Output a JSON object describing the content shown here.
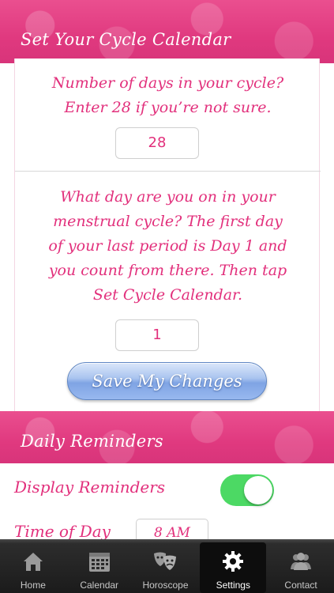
{
  "cycle_section": {
    "title": "Set Your Cycle Calendar",
    "days_prompt_line1": "Number of days in your cycle?",
    "days_prompt_line2": "Enter 28 if you’re not sure.",
    "days_value": "28",
    "day_prompt_line1": "What day are you on in your",
    "day_prompt_line2": "menstrual cycle? The first day",
    "day_prompt_line3": "of your last period is Day 1 and",
    "day_prompt_line4": "you count from there. Then tap",
    "day_prompt_line5": "Set Cycle Calendar.",
    "day_value": "1",
    "save_label": "Save My Changes"
  },
  "reminders_section": {
    "title": "Daily Reminders",
    "display_label": "Display Reminders",
    "display_on": true,
    "time_label": "Time of Day",
    "time_value": "8 AM"
  },
  "tabbar": {
    "tabs": [
      {
        "label": "Home",
        "icon": "home-icon"
      },
      {
        "label": "Calendar",
        "icon": "calendar-icon"
      },
      {
        "label": "Horoscope",
        "icon": "theater-masks-icon"
      },
      {
        "label": "Settings",
        "icon": "gear-icon",
        "active": true
      },
      {
        "label": "Contact",
        "icon": "people-icon"
      }
    ]
  },
  "colors": {
    "accent_pink": "#e2307c",
    "toggle_green": "#4cd964",
    "button_blue": "#7fa4e4"
  }
}
